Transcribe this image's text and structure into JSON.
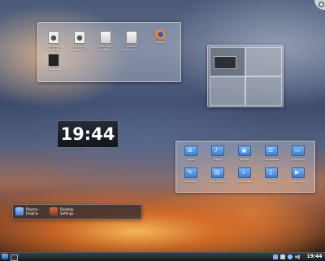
{
  "desktop_folder": {
    "icons": [
      {
        "label": "8136X-\nGlassyFlat...",
        "icon": "gear-icon"
      },
      {
        "label": "gtk-qt-\nengine-1...",
        "icon": "gear-icon"
      },
      {
        "label": "KDE-Four-\nLive.i686-...",
        "icon": "document-icon"
      },
      {
        "label": "kdesvn-\nbuild-1.6.1...",
        "icon": "document-icon"
      },
      {
        "label": "Firefox",
        "icon": "firefox-icon"
      },
      {
        "label": "nvidia.run",
        "icon": "terminal-icon"
      }
    ]
  },
  "clock": {
    "time": "19:44"
  },
  "folder_view": {
    "items": [
      {
        "label": "apps",
        "glyph": "⊞"
      },
      {
        "label": "Band",
        "glyph": "♪"
      },
      {
        "label": "Bilder",
        "glyph": "▣"
      },
      {
        "label": "Collovation",
        "glyph": "☰"
      },
      {
        "label": "Desktop",
        "glyph": "▭"
      },
      {
        "label": "Develop",
        "glyph": "✎"
      },
      {
        "label": "Documents",
        "glyph": "▤"
      },
      {
        "label": "Downloads",
        "glyph": "↓"
      },
      {
        "label": "Musik",
        "glyph": "♫"
      },
      {
        "label": "Videos",
        "glyph": "▶"
      }
    ]
  },
  "task_switcher": {
    "items": [
      {
        "line1": "Plasma -",
        "line2": "Dolphin"
      },
      {
        "line1": "Desktop",
        "line2": "Settings -"
      }
    ]
  },
  "taskbar": {
    "clock": "19:44"
  },
  "colors": {
    "accent": "#3c7fd0",
    "panel": "#d2d7e1",
    "taskbar": "#1e2026"
  }
}
